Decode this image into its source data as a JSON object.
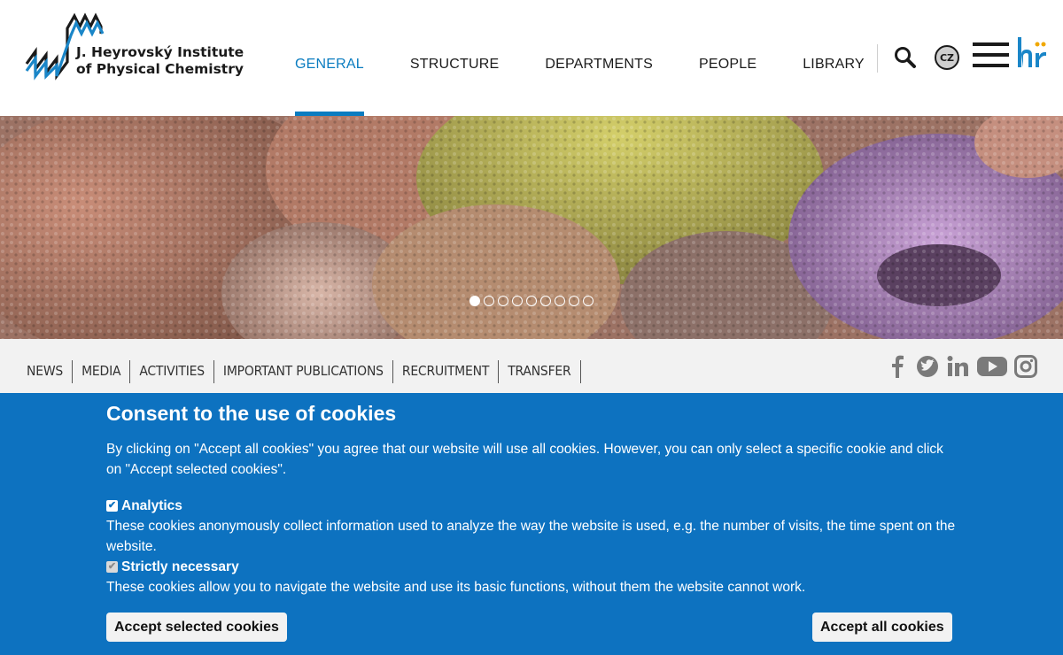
{
  "header": {
    "logo_line1": "J. Heyrovský Institute",
    "logo_line2": "of Physical Chemistry",
    "nav": [
      {
        "label": "GENERAL",
        "active": true
      },
      {
        "label": "STRUCTURE",
        "active": false
      },
      {
        "label": "DEPARTMENTS",
        "active": false
      },
      {
        "label": "PEOPLE",
        "active": false
      },
      {
        "label": "LIBRARY",
        "active": false
      }
    ],
    "lang_label": "CZ",
    "icons": {
      "search": "search-icon",
      "menu": "hamburger-menu-icon",
      "hr": "hr-award-logo"
    }
  },
  "hero": {
    "slide_count": 9,
    "active_slide": 1
  },
  "subnav": {
    "items": [
      "NEWS",
      "MEDIA",
      "ACTIVITIES",
      "IMPORTANT PUBLICATIONS",
      "RECRUITMENT",
      "TRANSFER"
    ],
    "social": [
      "facebook-icon",
      "twitter-icon",
      "linkedin-icon",
      "youtube-icon",
      "instagram-icon"
    ]
  },
  "cookie": {
    "title": "Consent to the use of cookies",
    "description": "By clicking on \"Accept all cookies\" you agree that our website will use all cookies. However, you can only select a specific cookie and click on \"Accept selected cookies\".",
    "options": [
      {
        "label": "Analytics",
        "checked": true,
        "disabled": false,
        "text": "These cookies anonymously collect information used to analyze the way the website is used, e.g. the number of visits, the time spent on the website."
      },
      {
        "label": "Strictly necessary",
        "checked": true,
        "disabled": true,
        "text": "These cookies allow you to navigate the website and use its basic functions, without them the website cannot work."
      }
    ],
    "accept_selected": "Accept selected cookies",
    "accept_all": "Accept all cookies"
  },
  "colors": {
    "accent": "#0a7cc0",
    "banner": "#0d72c0"
  }
}
